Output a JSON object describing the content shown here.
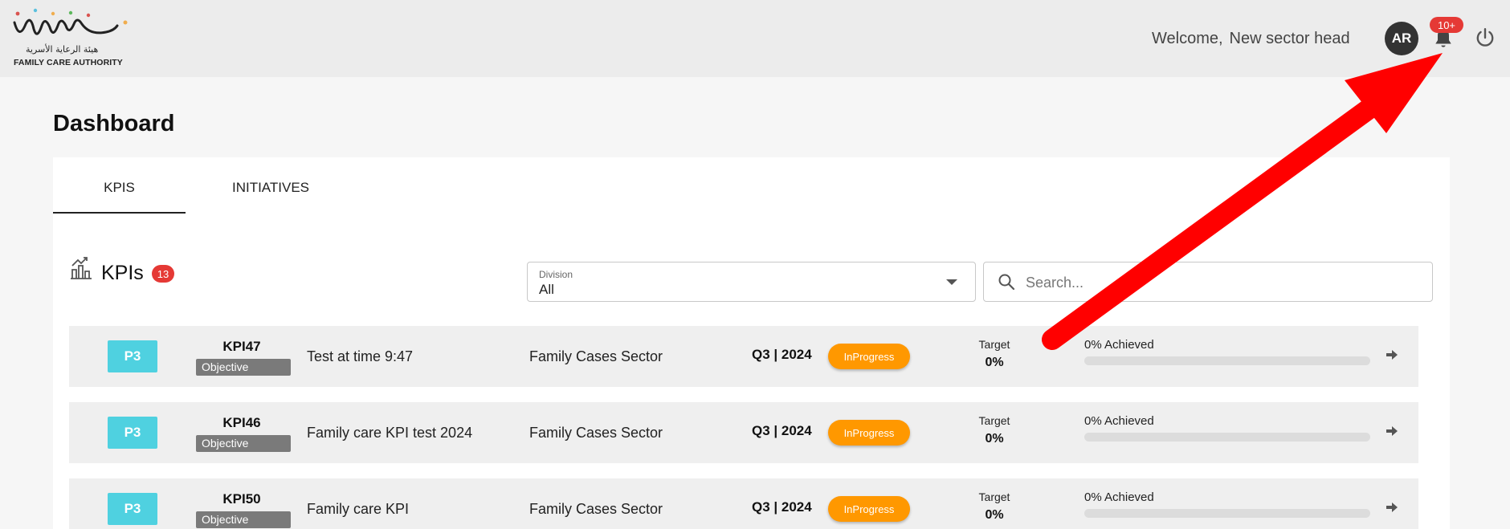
{
  "header": {
    "logo_ar": "هيئة الرعاية الأسرية",
    "logo_en": "FAMILY CARE AUTHORITY",
    "welcome_label": "Welcome,",
    "user_name": "New sector head",
    "avatar_initials": "AR",
    "notification_count": "10+"
  },
  "page": {
    "title": "Dashboard"
  },
  "tabs": [
    {
      "label": "KPIS",
      "active": true
    },
    {
      "label": "INITIATIVES",
      "active": false
    }
  ],
  "kpis": {
    "title": "KPIs",
    "count": "13",
    "division": {
      "label": "Division",
      "value": "All"
    },
    "search": {
      "placeholder": "Search..."
    },
    "rows": [
      {
        "priority": "P3",
        "code": "KPI47",
        "type": "Objective",
        "name": "Test at time 9:47",
        "sector": "Family Cases Sector",
        "period": "Q3 | 2024",
        "status": "InProgress",
        "target_label": "Target",
        "target_value": "0%",
        "achieved_label": "0% Achieved",
        "progress": 0
      },
      {
        "priority": "P3",
        "code": "KPI46",
        "type": "Objective",
        "name": "Family care KPI test 2024",
        "sector": "Family Cases Sector",
        "period": "Q3 | 2024",
        "status": "InProgress",
        "target_label": "Target",
        "target_value": "0%",
        "achieved_label": "0% Achieved",
        "progress": 0
      },
      {
        "priority": "P3",
        "code": "KPI50",
        "type": "Objective",
        "name": "Family care KPI",
        "sector": "Family Cases Sector",
        "period": "Q3 | 2024",
        "status": "InProgress",
        "target_label": "Target",
        "target_value": "0%",
        "achieved_label": "0% Achieved",
        "progress": 0
      }
    ]
  },
  "colors": {
    "priority": "#4fd1e0",
    "status_inprogress": "#ff9800",
    "badge": "#e53935",
    "annotation_arrow": "#ff0000"
  },
  "icons": [
    "bell-icon",
    "power-icon",
    "kpi-chart-icon",
    "search-icon",
    "chevron-down-icon",
    "arrow-right-icon"
  ]
}
